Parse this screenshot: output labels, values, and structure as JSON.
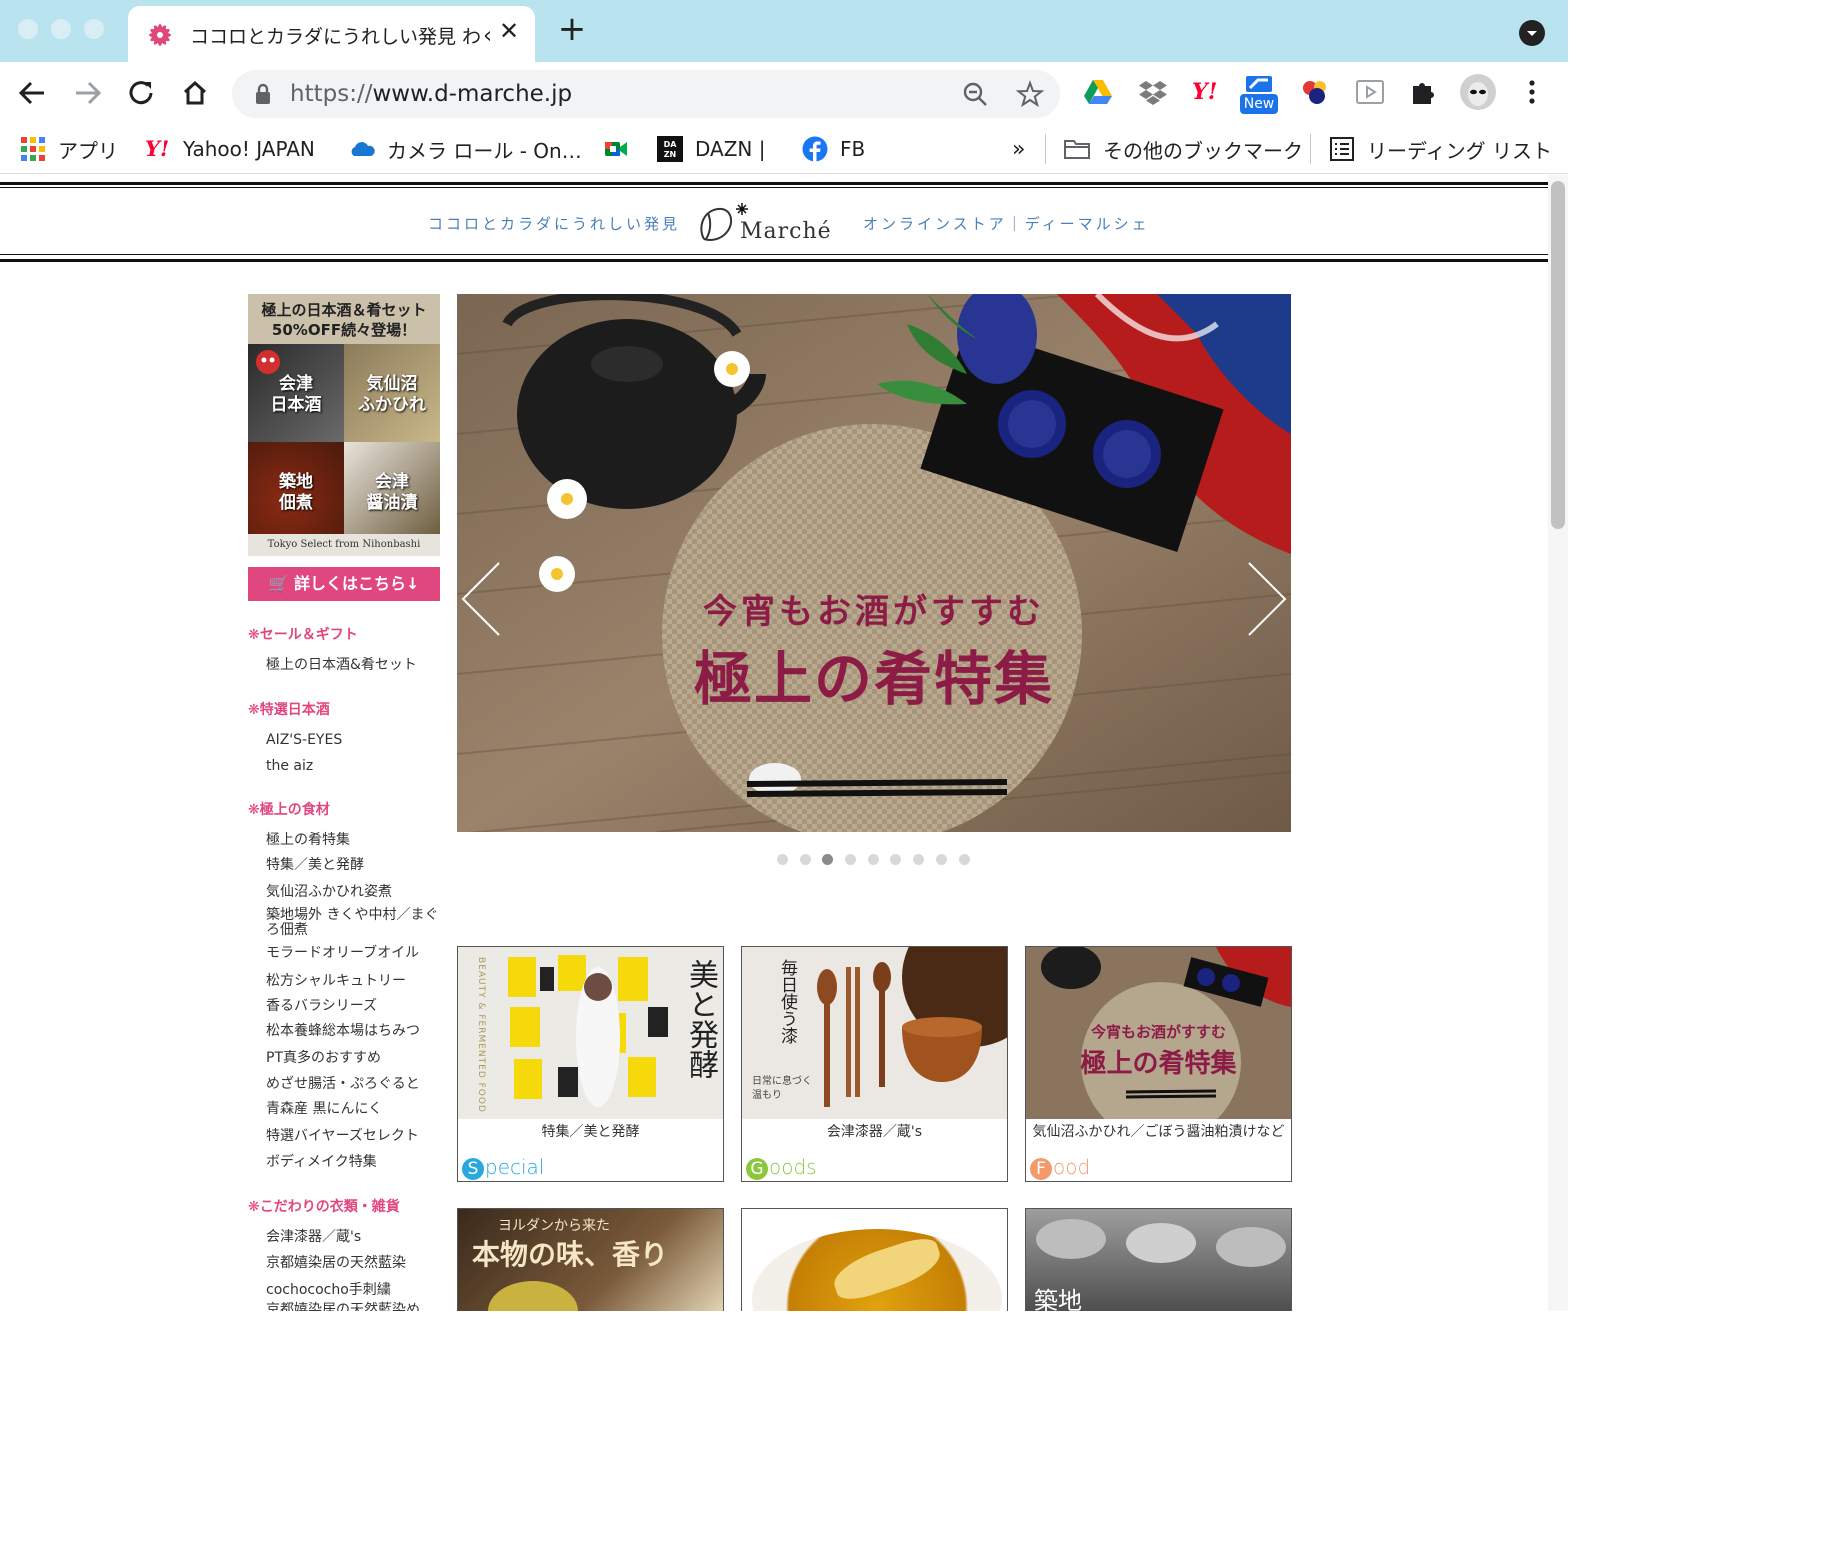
{
  "browser": {
    "tab_title": "ココロとカラダにうれしい発見 わくわく",
    "url_scheme": "https://",
    "url_host": "www.d-marche.jp",
    "ext_badge": "New",
    "bookmarks": [
      {
        "label": "アプリ",
        "icon": "apps-grid-icon"
      },
      {
        "label": "Yahoo! JAPAN",
        "icon": "yahoo-icon"
      },
      {
        "label": "カメラ ロール - On…",
        "icon": "onedrive-icon"
      },
      {
        "label": "",
        "icon": "google-meet-icon"
      },
      {
        "label": "DAZN |",
        "icon": "dazn-icon"
      },
      {
        "label": "FB",
        "icon": "facebook-icon"
      }
    ],
    "bookmarks_overflow": "»",
    "other_bookmarks": "その他のブックマーク",
    "reading_list": "リーディング リスト"
  },
  "header": {
    "tagline_left": "ココロとカラダにうれしい発見",
    "logo_text": "Marché",
    "tagline_right": "オンラインストア｜ディーマルシェ"
  },
  "side_banner": {
    "headline1": "極上の日本酒＆肴セット",
    "headline2": "50%OFF続々登場！",
    "tile1": "会津\n日本酒",
    "tile2": "気仙沼\nふかひれ",
    "tile3": "築地\n佃煮",
    "tile4": "会津\n醤油漬",
    "footer": "Tokyo Select from Nihonbashi"
  },
  "detail_button": "詳しくはこちら↓",
  "categories": [
    {
      "title": "セール＆ギフト",
      "items": [
        "極上の日本酒&肴セット"
      ]
    },
    {
      "title": "特選日本酒",
      "items": [
        "AIZ'S-EYES",
        "the aiz"
      ]
    },
    {
      "title": "極上の食材",
      "items": [
        "極上の肴特集",
        "特集／美と発酵",
        "気仙沼ふかひれ姿煮",
        "築地場外 きくや中村／まぐろ佃煮",
        "モラードオリーブオイル",
        "松方シャルキュトリー",
        "香るバラシリーズ",
        "松本養蜂総本場はちみつ",
        "PT真多のおすすめ",
        "めざせ腸活・ぷろぐると",
        "青森産 黒にんにく",
        "特選バイヤーズセレクト",
        "ボディメイク特集"
      ]
    },
    {
      "title": "こだわりの衣類・雑貨",
      "items": [
        "会津漆器／蔵's",
        "京都嬉染居の天然藍染",
        "cochococho手刺繍",
        "京都嬉染居の天然藍染め"
      ]
    }
  ],
  "hero": {
    "title_small": "今宵もお酒がすすむ",
    "title_large": "極上の肴特集",
    "slide_count": 9,
    "active_slide": 3
  },
  "cards": [
    {
      "caption": "特集／美と発酵",
      "tag_letter": "S",
      "tag_rest": "pecial",
      "tag_color": "#29a8e0",
      "image_text": "美と発酵",
      "side_text": "BEAUTY & FERMENTED FOOD"
    },
    {
      "caption": "会津漆器／蔵's",
      "tag_letter": "G",
      "tag_rest": "oods",
      "tag_color": "#8cc63f",
      "image_text": "毎日使う漆",
      "side_text": "日常に息づく温もり"
    },
    {
      "caption": "気仙沼ふかひれ／ごぼう醤油粕漬けなど",
      "tag_letter": "F",
      "tag_rest": "ood",
      "tag_color": "#f39a6b",
      "image_text": "極上の肴特集",
      "side_text": "今宵もお酒がすすむ"
    }
  ],
  "cards_row2": [
    {
      "image_text": "本物の味、香り",
      "side_text": "ヨルダンから来た"
    },
    {
      "image_text": ""
    },
    {
      "image_text": "築地"
    }
  ]
}
